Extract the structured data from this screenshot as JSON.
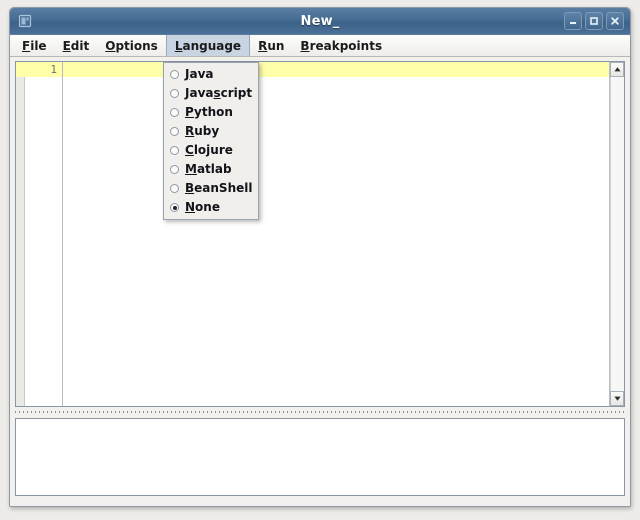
{
  "window": {
    "title": "New_",
    "app_icon": "application-window-icon",
    "controls": [
      {
        "name": "minimize-button",
        "glyph": "minimize-icon"
      },
      {
        "name": "maximize-button",
        "glyph": "maximize-icon"
      },
      {
        "name": "close-button",
        "glyph": "close-icon"
      }
    ]
  },
  "menubar": {
    "items": [
      {
        "label": "File",
        "pre": "",
        "mnemonic": "F",
        "post": "ile",
        "open": false
      },
      {
        "label": "Edit",
        "pre": "",
        "mnemonic": "E",
        "post": "dit",
        "open": false
      },
      {
        "label": "Options",
        "pre": "",
        "mnemonic": "O",
        "post": "ptions",
        "open": false
      },
      {
        "label": "Language",
        "pre": "",
        "mnemonic": "L",
        "post": "anguage",
        "open": true
      },
      {
        "label": "Run",
        "pre": "",
        "mnemonic": "R",
        "post": "un",
        "open": false
      },
      {
        "label": "Breakpoints",
        "pre": "",
        "mnemonic": "B",
        "post": "reakpoints",
        "open": false
      }
    ]
  },
  "language_menu": {
    "open_for": "Language",
    "items": [
      {
        "label": "Java",
        "pre": "",
        "mnemonic": "J",
        "post": "ava",
        "selected": false
      },
      {
        "label": "Javascript",
        "pre": "Java",
        "mnemonic": "s",
        "post": "cript",
        "selected": false
      },
      {
        "label": "Python",
        "pre": "",
        "mnemonic": "P",
        "post": "ython",
        "selected": false
      },
      {
        "label": "Ruby",
        "pre": "",
        "mnemonic": "R",
        "post": "uby",
        "selected": false
      },
      {
        "label": "Clojure",
        "pre": "",
        "mnemonic": "C",
        "post": "lojure",
        "selected": false
      },
      {
        "label": "Matlab",
        "pre": "",
        "mnemonic": "M",
        "post": "atlab",
        "selected": false
      },
      {
        "label": "BeanShell",
        "pre": "",
        "mnemonic": "B",
        "post": "eanShell",
        "selected": false
      },
      {
        "label": "None",
        "pre": "",
        "mnemonic": "N",
        "post": "one",
        "selected": true
      }
    ]
  },
  "editor": {
    "lines": [
      {
        "number": "1",
        "text": "",
        "current": true
      }
    ],
    "current_line_color": "#ffffaa",
    "scrollbar": {
      "up_arrow": "scroll-up-icon",
      "down_arrow": "scroll-down-icon"
    }
  },
  "output": {
    "text": ""
  },
  "colors": {
    "titlebar": "#456c93",
    "menu_highlight": "#c8d4e2",
    "current_line": "#ffffaa",
    "frame": "#8d99a6"
  }
}
